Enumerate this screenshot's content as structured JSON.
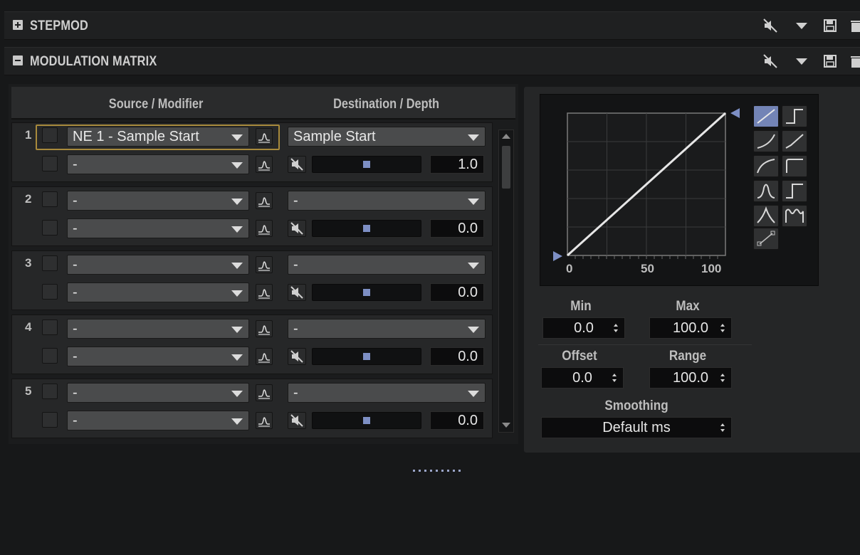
{
  "sections": {
    "stepmod": {
      "title": "STEPMOD",
      "expanded": false
    },
    "modulation_matrix": {
      "title": "MODULATION MATRIX",
      "expanded": true
    }
  },
  "matrix": {
    "source_header": "Source / Modifier",
    "destination_header": "Destination / Depth",
    "slots": [
      {
        "number": "1",
        "source": "NE 1 - Sample Start",
        "modifier": "-",
        "destination": "Sample Start",
        "depth": "1.0",
        "depth_level": 0.5,
        "highlighted": true
      },
      {
        "number": "2",
        "source": "-",
        "modifier": "-",
        "destination": "-",
        "depth": "0.0",
        "depth_level": 0.5,
        "highlighted": false
      },
      {
        "number": "3",
        "source": "-",
        "modifier": "-",
        "destination": "-",
        "depth": "0.0",
        "depth_level": 0.5,
        "highlighted": false
      },
      {
        "number": "4",
        "source": "-",
        "modifier": "-",
        "destination": "-",
        "depth": "0.0",
        "depth_level": 0.5,
        "highlighted": false
      },
      {
        "number": "5",
        "source": "-",
        "modifier": "-",
        "destination": "-",
        "depth": "0.0",
        "depth_level": 0.5,
        "highlighted": false
      }
    ]
  },
  "curve_editor": {
    "axis_ticks": [
      "0",
      "50",
      "100"
    ],
    "selected_shape": "linear",
    "shapes": [
      "linear",
      "step-up",
      "exp-curve",
      "late-linear",
      "log-curve",
      "square-step",
      "bell",
      "step-rise",
      "triangle",
      "multi-hump",
      "custom-line"
    ]
  },
  "params": {
    "min": {
      "label": "Min",
      "value": "0.0"
    },
    "max": {
      "label": "Max",
      "value": "100.0"
    },
    "offset": {
      "label": "Offset",
      "value": "0.0"
    },
    "range": {
      "label": "Range",
      "value": "100.0"
    },
    "smoothing": {
      "label": "Smoothing",
      "value": "Default ms"
    }
  },
  "colors": {
    "accent": "#7384b6",
    "highlight_border": "#a88a3c",
    "background": "#171819"
  }
}
